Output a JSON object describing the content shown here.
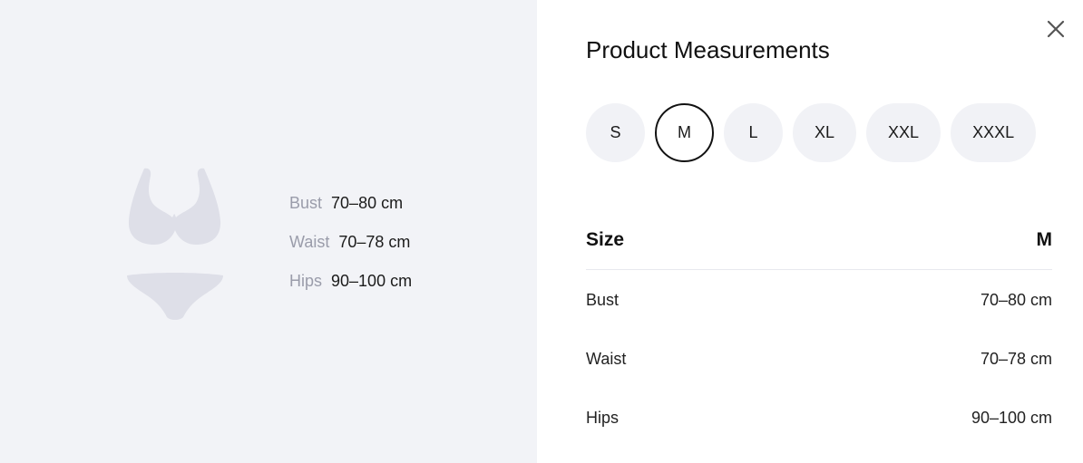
{
  "dialog": {
    "title": "Product Measurements",
    "close_icon": "close-icon"
  },
  "left_panel": {
    "illustration_icon": "bikini-silhouette-icon",
    "measurements": [
      {
        "label": "Bust",
        "value": "70–80 cm"
      },
      {
        "label": "Waist",
        "value": "70–78 cm"
      },
      {
        "label": "Hips",
        "value": "90–100 cm"
      }
    ]
  },
  "sizes": {
    "options": [
      "S",
      "M",
      "L",
      "XL",
      "XXL",
      "XXXL"
    ],
    "selected": "M"
  },
  "table": {
    "header": {
      "label": "Size",
      "value": "M"
    },
    "rows": [
      {
        "label": "Bust",
        "value": "70–80 cm"
      },
      {
        "label": "Waist",
        "value": "70–78 cm"
      },
      {
        "label": "Hips",
        "value": "90–100 cm"
      }
    ]
  },
  "colors": {
    "left_bg": "#f2f3f7",
    "chip_bg": "#f1f2f6",
    "selected_border": "#111111",
    "muted_label": "#9a9caa",
    "illustration": "#dedfe8"
  }
}
